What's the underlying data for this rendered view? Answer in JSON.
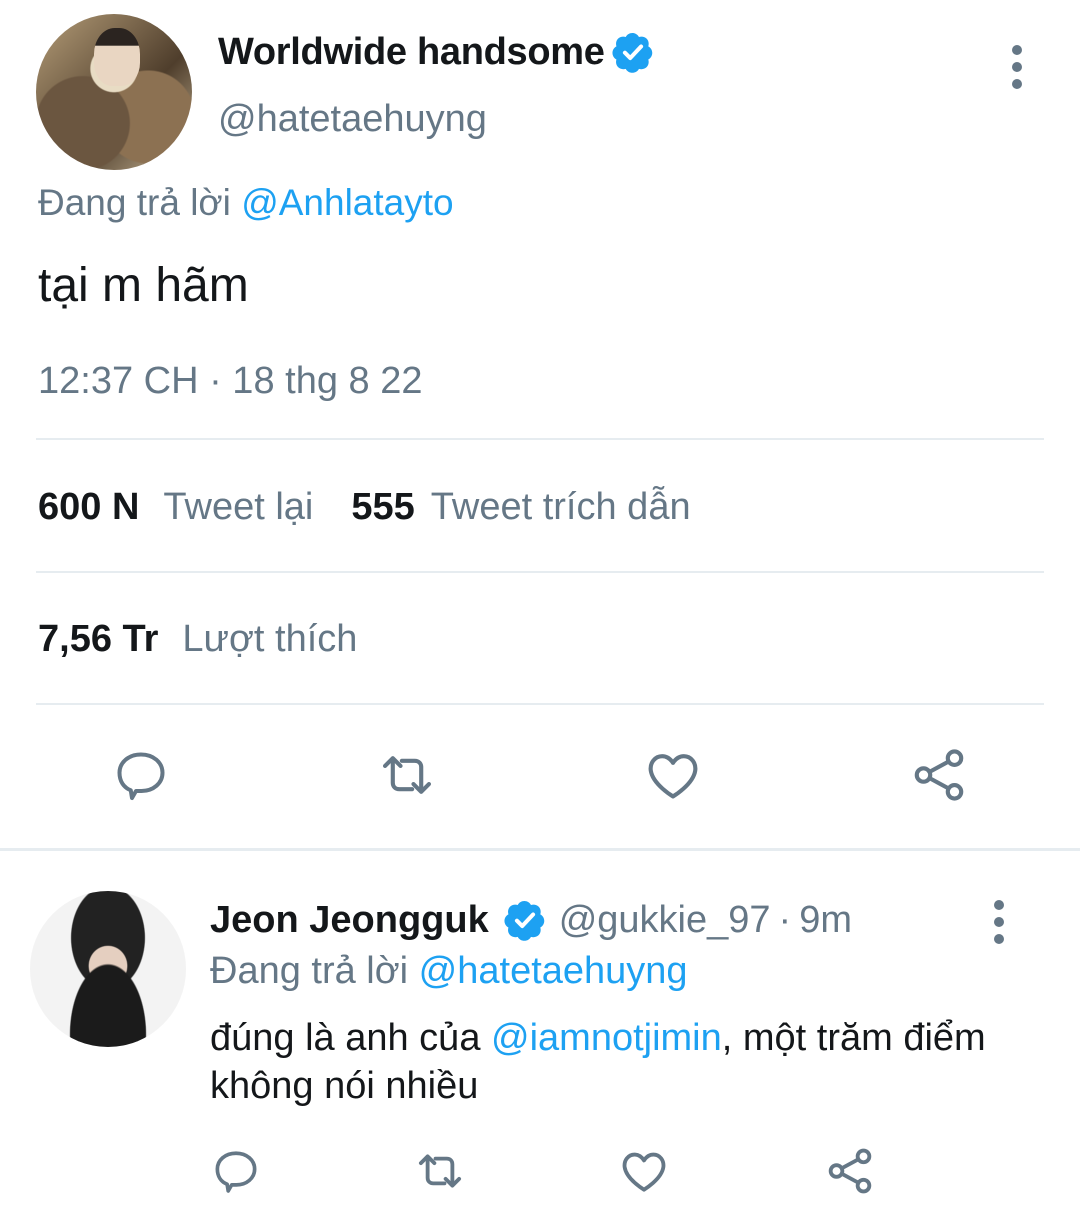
{
  "tweet": {
    "author": {
      "display_name": "Worldwide handsome",
      "handle": "@hatetaehuyng",
      "verified": true
    },
    "replying_to_label": "Đang trả lời",
    "replying_to_handle": "@Anhlatayto",
    "text": "tại m hãm",
    "timestamp": "12:37 CH · 18 thg 8 22",
    "stats": {
      "retweets_count": "600 N",
      "retweets_label": "Tweet lại",
      "quotes_count": "555",
      "quotes_label": "Tweet trích dẫn",
      "likes_count": "7,56 Tr",
      "likes_label": "Lượt thích"
    },
    "actions": [
      "reply-icon",
      "retweet-icon",
      "like-icon",
      "share-icon"
    ]
  },
  "reply": {
    "author": {
      "display_name": "Jeon Jeongguk",
      "handle": "@gukkie_97",
      "verified": true
    },
    "separator": "·",
    "time_ago": "9m",
    "replying_to_label": "Đang trả lời",
    "replying_to_handle": "@hatetaehuyng",
    "text_before": "đúng là anh của ",
    "text_mention": "@iamnotjimin",
    "text_after": ", một trăm điểm không nói nhiều",
    "actions": [
      "reply-icon",
      "retweet-icon",
      "like-icon",
      "share-icon"
    ]
  },
  "colors": {
    "accent": "#1da1f2",
    "secondary_text": "#657786",
    "primary_text": "#14171a",
    "divider": "#e6ecf0"
  }
}
